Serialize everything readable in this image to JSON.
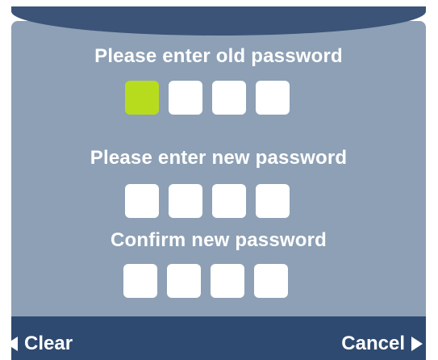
{
  "screen": {
    "old_password": {
      "label": "Please enter old password",
      "digits_entered": 0,
      "digits_total": 4
    },
    "new_password": {
      "label": "Please enter new password",
      "digits_entered": 0,
      "digits_total": 4
    },
    "confirm_password": {
      "label": "Confirm new password",
      "digits_entered": 0,
      "digits_total": 4
    }
  },
  "softkeys": {
    "left_label": "Clear",
    "right_label": "Cancel"
  },
  "colors": {
    "panel": "#8da0b5",
    "header": "#3b5478",
    "bottom_bar": "#2f4a70",
    "active_box": "#b7dc1e",
    "box": "#ffffff",
    "text": "#ffffff"
  },
  "icons": {
    "left_arrow": "triangle-left",
    "right_arrow": "triangle-right"
  }
}
